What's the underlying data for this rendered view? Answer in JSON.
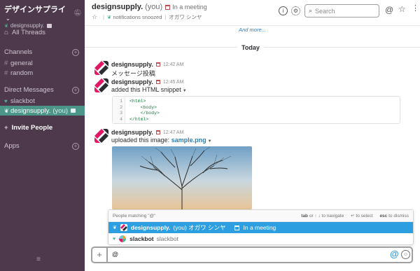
{
  "team": {
    "name": "デザインサプライ",
    "user": "designsupply."
  },
  "sidebar": {
    "all_threads": "All Threads",
    "channels_title": "Channels",
    "channels": [
      "general",
      "random"
    ],
    "dm_title": "Direct Messages",
    "dms": [
      {
        "name": "slackbot"
      },
      {
        "name": "designsupply.",
        "suffix": "(you)"
      }
    ],
    "invite": "Invite People",
    "apps": "Apps"
  },
  "header": {
    "channel_name": "designsupply.",
    "you": "(you)",
    "status": "In a meeting",
    "sub_notifications": "notifications snoozed",
    "sub_name": "オガワ シンヤ",
    "search_placeholder": "Search"
  },
  "messages": {
    "and_more": "And more...",
    "day": "Today",
    "items": [
      {
        "author": "designsupply.",
        "time": "12:42 AM",
        "text": "メッセージ投稿"
      },
      {
        "author": "designsupply.",
        "time": "12:45 AM",
        "text": "added this HTML snippet"
      },
      {
        "author": "designsupply.",
        "time": "12:47 AM",
        "text": "uploaded this image:",
        "link": "sample.png"
      }
    ],
    "snippet_lines": [
      "1",
      "2",
      "3",
      "4"
    ],
    "snippet_code": "<html>\n    <body>\n    </body>\n</html>"
  },
  "mention_popup": {
    "title": "People matching \"@\"",
    "hint_nav_key": "tab",
    "hint_nav_rest": " or ↑ ↓ to navigate",
    "hint_select": "↵ to select",
    "hint_dismiss_key": "esc",
    "hint_dismiss_rest": " to dismiss",
    "rows": [
      {
        "name": "designsupply.",
        "extra": "(you)  オガワ シンヤ",
        "status": "In a meeting"
      },
      {
        "name": "slackbot",
        "extra": "slackbot"
      }
    ]
  },
  "composer": {
    "value": "@"
  },
  "colors": {
    "sidebar_bg": "#4d394b",
    "active_item": "#4c9689",
    "popup_selected": "#2d9ee0",
    "link": "#2a80b9"
  }
}
